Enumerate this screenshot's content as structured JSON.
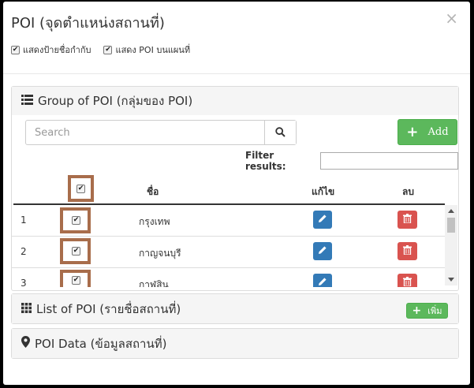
{
  "modal": {
    "title": "POI (จุดตำแหน่งสถานที่)",
    "close": "×"
  },
  "options": [
    {
      "label": "แสดงป้ายชื่อกำกับ",
      "checked": true
    },
    {
      "label": "แสดง POI บนแผนที่",
      "checked": true
    }
  ],
  "group_panel": {
    "title": "Group of POI (กลุ่มของ POI)",
    "icon": "list-icon",
    "search_placeholder": "Search",
    "add_label": "Add",
    "filter_label": "Filter results:",
    "columns": {
      "select": "",
      "name": "ชื่อ",
      "edit": "แก้ไข",
      "delete": "ลบ"
    },
    "rows": [
      {
        "num": "1",
        "name": "กรุงเทพ",
        "checked": true
      },
      {
        "num": "2",
        "name": "กาญจนบุรี",
        "checked": true
      },
      {
        "num": "3",
        "name": "กาฬสิน",
        "checked": true
      }
    ]
  },
  "list_panel": {
    "title": "List of POI (รายชื่อสถานที่)",
    "icon": "grid-icon",
    "add_label": "เพิ่ม"
  },
  "data_panel": {
    "title": "POI Data (ข้อมูลสถานที่)",
    "icon": "map-marker-icon"
  },
  "colors": {
    "success": "#5cb85c",
    "primary": "#337ab7",
    "danger": "#d9534f",
    "highlight": "#a86d4b"
  }
}
